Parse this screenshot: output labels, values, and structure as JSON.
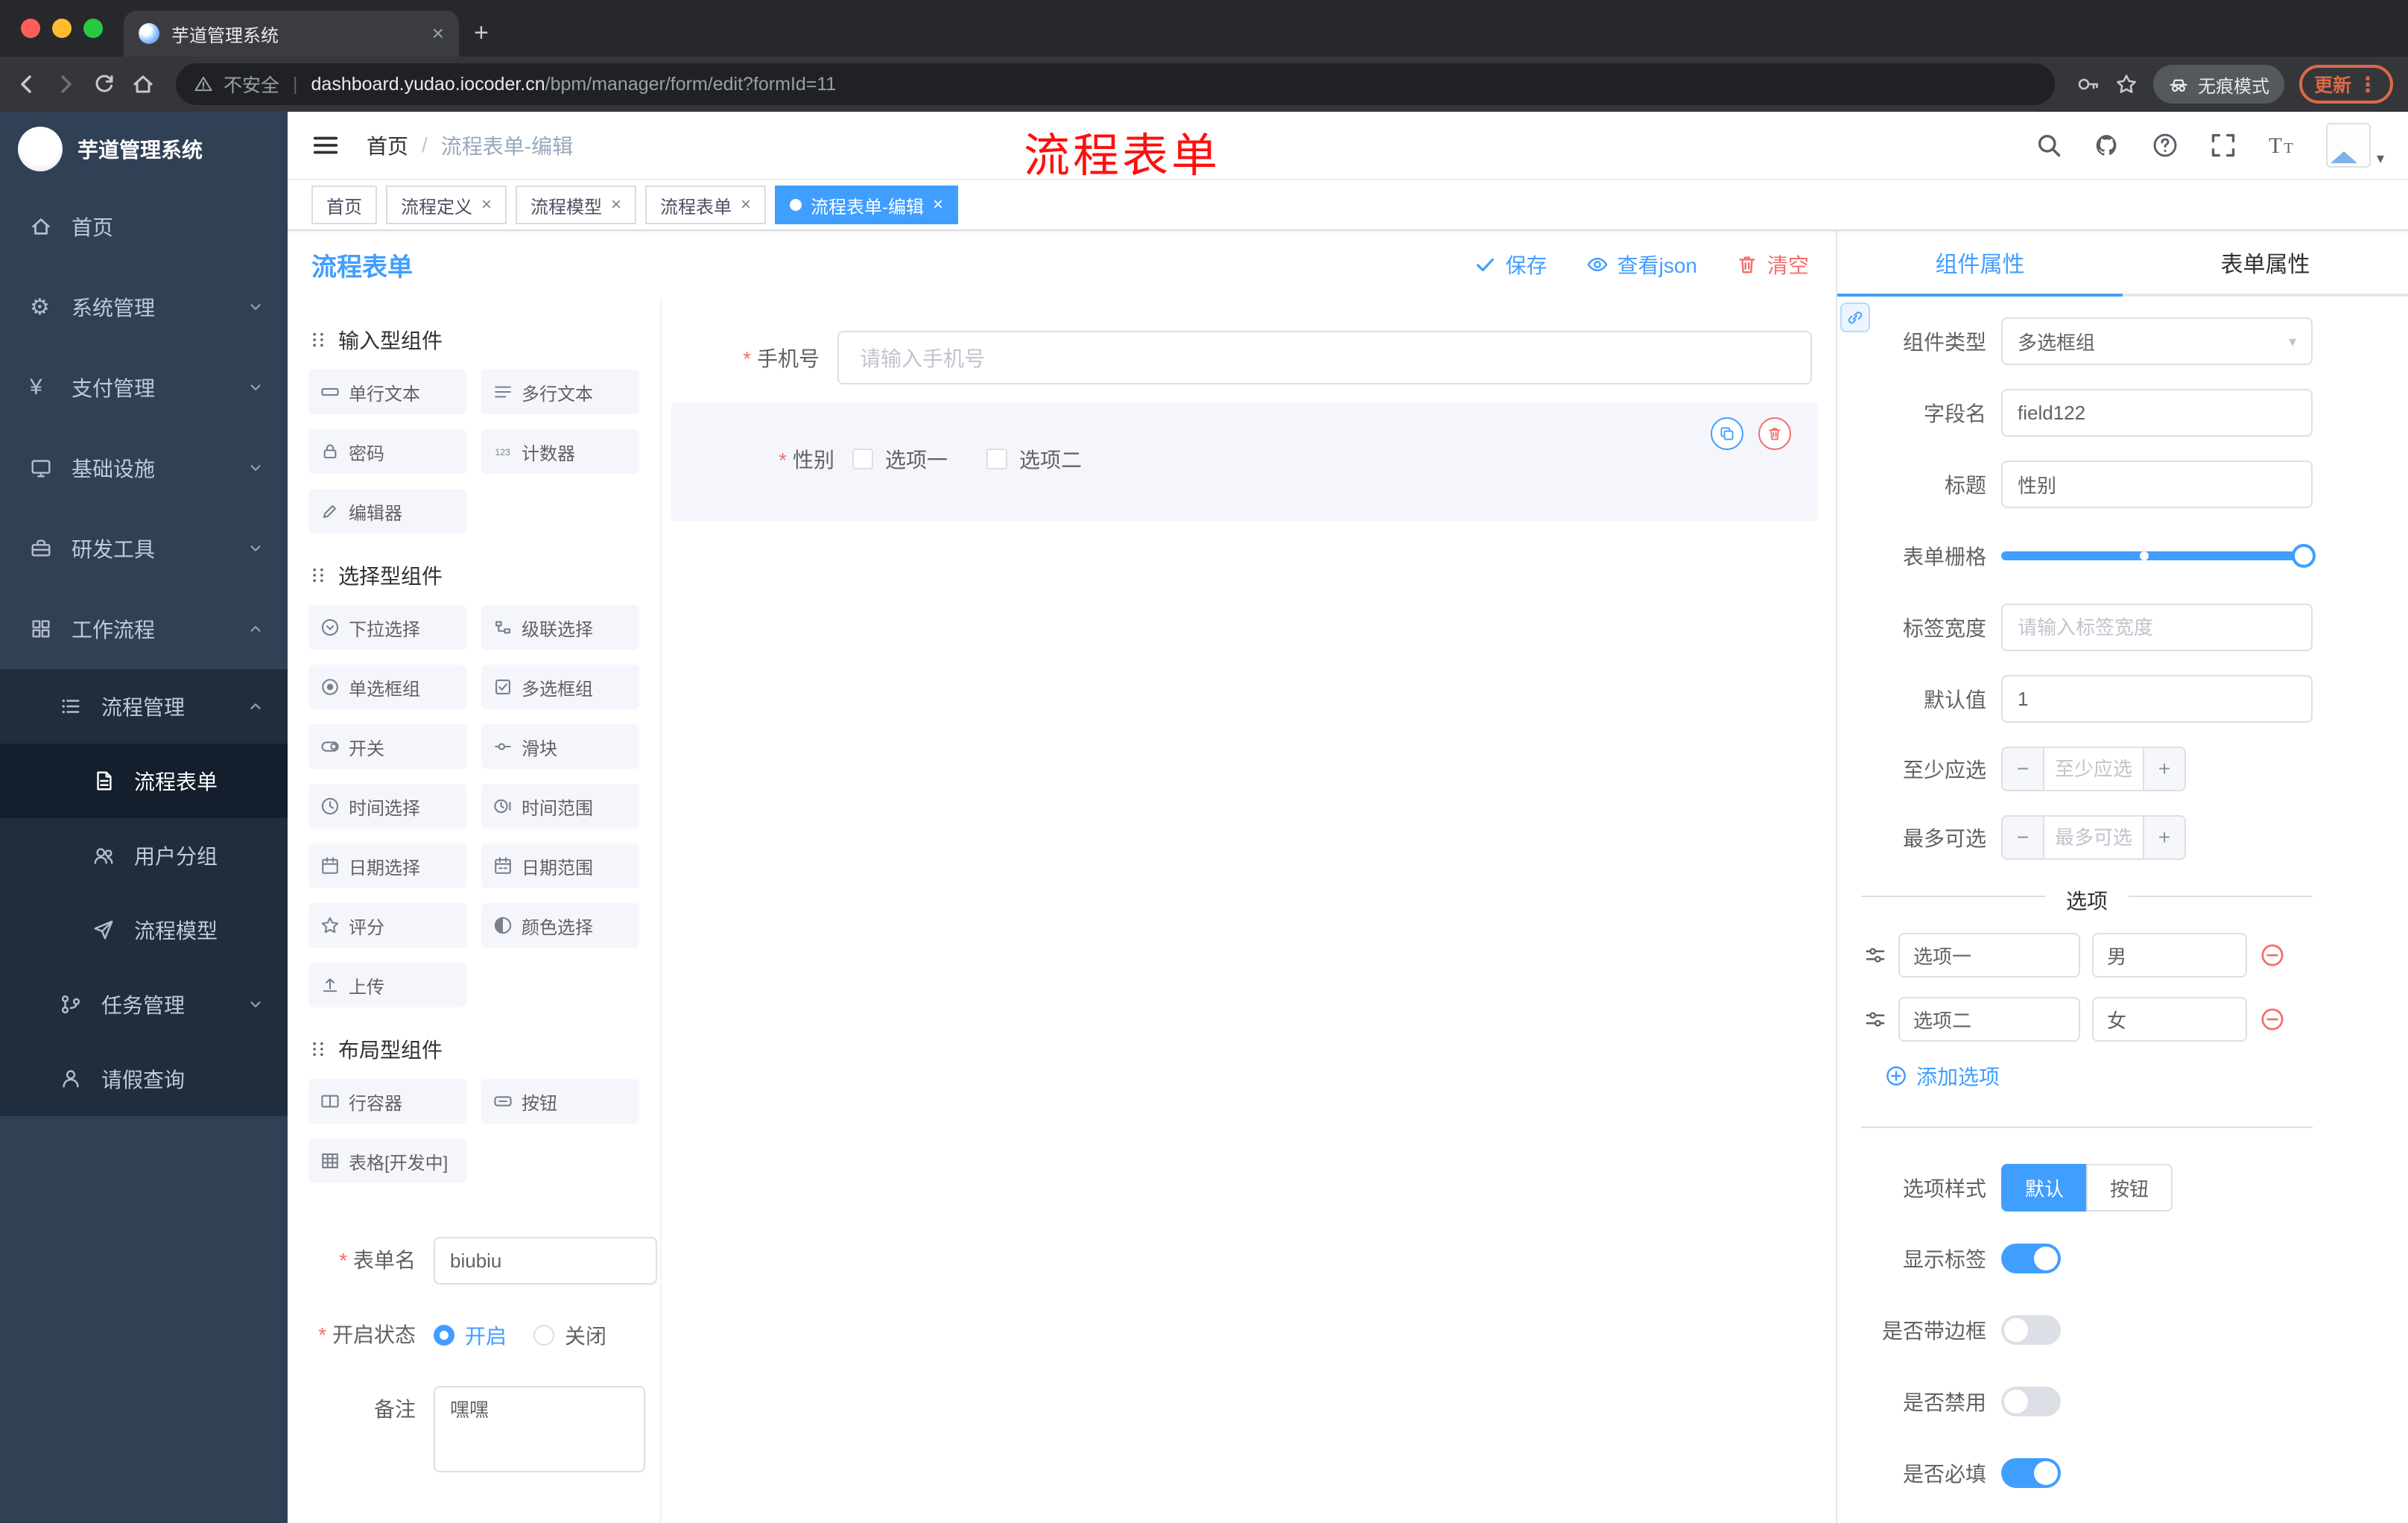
{
  "colors": {
    "accent": "#409eff",
    "danger": "#f56c6c",
    "annotation": "#fe1010",
    "sidebar_bg": "#304156"
  },
  "browser": {
    "tab_title": "芋道管理系统",
    "security_label": "不安全",
    "url_domain": "dashboard.yudao.iocoder.cn",
    "url_path": "/bpm/manager/form/edit?formId=11",
    "incognito_label": "无痕模式",
    "update_label": "更新"
  },
  "sidebar": {
    "logo_title": "芋道管理系统",
    "items": [
      {
        "key": "home",
        "label": "首页",
        "icon": "home",
        "level": 0,
        "sub": false,
        "chev": ""
      },
      {
        "key": "system-mgmt",
        "label": "系统管理",
        "icon": "gear",
        "level": 0,
        "sub": false,
        "chev": "down"
      },
      {
        "key": "payment-mgmt",
        "label": "支付管理",
        "icon": "yen",
        "level": 0,
        "sub": false,
        "chev": "down"
      },
      {
        "key": "infrastructure",
        "label": "基础设施",
        "icon": "monitor",
        "level": 0,
        "sub": false,
        "chev": "down"
      },
      {
        "key": "dev-tools",
        "label": "研发工具",
        "icon": "tools",
        "level": 0,
        "sub": false,
        "chev": "down"
      },
      {
        "key": "workflow",
        "label": "工作流程",
        "icon": "grid",
        "level": 0,
        "sub": false,
        "chev": "up"
      },
      {
        "key": "process-mgmt",
        "label": "流程管理",
        "icon": "list",
        "level": 1,
        "sub": true,
        "chev": "up"
      },
      {
        "key": "process-form",
        "label": "流程表单",
        "icon": "doc",
        "level": 2,
        "sub": true,
        "chev": "",
        "active": true
      },
      {
        "key": "user-group",
        "label": "用户分组",
        "icon": "users",
        "level": 2,
        "sub": true,
        "chev": ""
      },
      {
        "key": "process-model",
        "label": "流程模型",
        "icon": "send",
        "level": 2,
        "sub": true,
        "chev": ""
      },
      {
        "key": "task-mgmt",
        "label": "任务管理",
        "icon": "branch",
        "level": 1,
        "sub": true,
        "chev": "down"
      },
      {
        "key": "leave-query",
        "label": "请假查询",
        "icon": "person",
        "level": 1,
        "sub": true,
        "chev": ""
      }
    ]
  },
  "header": {
    "breadcrumb_home": "首页",
    "breadcrumb_sep": "/",
    "breadcrumb_current": "流程表单-编辑",
    "annotation": "流程表单"
  },
  "tags": [
    {
      "key": "home",
      "label": "首页",
      "closable": false,
      "active": false
    },
    {
      "key": "process-definition",
      "label": "流程定义",
      "closable": true,
      "active": false
    },
    {
      "key": "process-model",
      "label": "流程模型",
      "closable": true,
      "active": false
    },
    {
      "key": "process-form",
      "label": "流程表单",
      "closable": true,
      "active": false
    },
    {
      "key": "process-form-edit",
      "label": "流程表单-编辑",
      "closable": true,
      "active": true
    }
  ],
  "designer": {
    "title": "流程表单",
    "actions": {
      "save": "保存",
      "view_json": "查看json",
      "clear": "清空"
    },
    "palette": {
      "groups": [
        {
          "title": "输入型组件",
          "items": [
            {
              "key": "single-text",
              "label": "单行文本",
              "icon": "line"
            },
            {
              "key": "multi-text",
              "label": "多行文本",
              "icon": "lines"
            },
            {
              "key": "password",
              "label": "密码",
              "icon": "lock"
            },
            {
              "key": "counter",
              "label": "计数器",
              "icon": "counter"
            },
            {
              "key": "editor",
              "label": "编辑器",
              "icon": "edit"
            }
          ]
        },
        {
          "title": "选择型组件",
          "items": [
            {
              "key": "select",
              "label": "下拉选择",
              "icon": "select"
            },
            {
              "key": "cascader",
              "label": "级联选择",
              "icon": "cascade"
            },
            {
              "key": "radio-group",
              "label": "单选框组",
              "icon": "radio"
            },
            {
              "key": "checkbox-group",
              "label": "多选框组",
              "icon": "checkbox"
            },
            {
              "key": "switch",
              "label": "开关",
              "icon": "switch"
            },
            {
              "key": "slider",
              "label": "滑块",
              "icon": "slider"
            },
            {
              "key": "time-picker",
              "label": "时间选择",
              "icon": "time"
            },
            {
              "key": "time-range",
              "label": "时间范围",
              "icon": "timerange"
            },
            {
              "key": "date-picker",
              "label": "日期选择",
              "icon": "date"
            },
            {
              "key": "date-range",
              "label": "日期范围",
              "icon": "daterange"
            },
            {
              "key": "rate",
              "label": "评分",
              "icon": "star"
            },
            {
              "key": "color-picker",
              "label": "颜色选择",
              "icon": "color"
            },
            {
              "key": "upload",
              "label": "上传",
              "icon": "upload"
            }
          ]
        },
        {
          "title": "布局型组件",
          "items": [
            {
              "key": "row-container",
              "label": "行容器",
              "icon": "row"
            },
            {
              "key": "button",
              "label": "按钮",
              "icon": "button"
            },
            {
              "key": "table",
              "label": "表格[开发中]",
              "icon": "table"
            }
          ]
        }
      ]
    },
    "canvas": {
      "phone": {
        "label": "手机号",
        "placeholder": "请输入手机号"
      },
      "gender": {
        "label": "性别",
        "options": [
          "选项一",
          "选项二"
        ]
      }
    },
    "meta": {
      "name_label": "表单名",
      "name_value": "biubiu",
      "status_label": "开启状态",
      "status_on": "开启",
      "status_off": "关闭",
      "remark_label": "备注",
      "remark_value": "嘿嘿"
    }
  },
  "properties": {
    "tab_component": "组件属性",
    "tab_form": "表单属性",
    "component_type_label": "组件类型",
    "component_type_value": "多选框组",
    "field_name_label": "字段名",
    "field_name_value": "field122",
    "title_label": "标题",
    "title_value": "性别",
    "grid_label": "表单栅格",
    "label_width_label": "标签宽度",
    "label_width_placeholder": "请输入标签宽度",
    "default_label": "默认值",
    "default_value": "1",
    "min_label": "至少应选",
    "min_placeholder": "至少应选",
    "max_label": "最多可选",
    "max_placeholder": "最多可选",
    "options_title": "选项",
    "options": [
      {
        "name": "选项一",
        "value": "男"
      },
      {
        "name": "选项二",
        "value": "女"
      }
    ],
    "add_option": "添加选项",
    "style_label": "选项样式",
    "style_default": "默认",
    "style_button": "按钮",
    "toggles": [
      {
        "key": "show-label",
        "label": "显示标签",
        "on": true
      },
      {
        "key": "border",
        "label": "是否带边框",
        "on": false
      },
      {
        "key": "disabled",
        "label": "是否禁用",
        "on": false
      },
      {
        "key": "required",
        "label": "是否必填",
        "on": true
      }
    ]
  }
}
